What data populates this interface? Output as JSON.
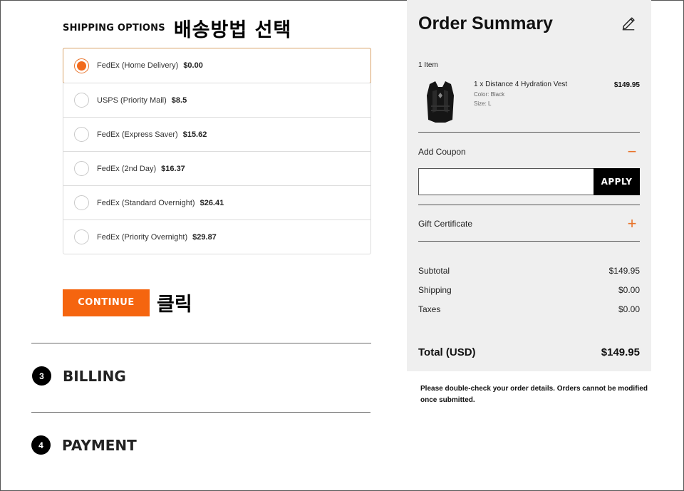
{
  "shipping": {
    "heading": "SHIPPING OPTIONS",
    "annotation": "배송방법 선택",
    "options": [
      {
        "name": "FedEx (Home Delivery)",
        "price": "$0.00",
        "selected": true
      },
      {
        "name": "USPS (Priority Mail)",
        "price": "$8.5",
        "selected": false
      },
      {
        "name": "FedEx (Express Saver)",
        "price": "$15.62",
        "selected": false
      },
      {
        "name": "FedEx (2nd Day)",
        "price": "$16.37",
        "selected": false
      },
      {
        "name": "FedEx (Standard Overnight)",
        "price": "$26.41",
        "selected": false
      },
      {
        "name": "FedEx (Priority Overnight)",
        "price": "$29.87",
        "selected": false
      }
    ],
    "continue_label": "CONTINUE",
    "click_annotation": "클릭"
  },
  "steps": [
    {
      "number": "3",
      "label": "BILLING"
    },
    {
      "number": "4",
      "label": "PAYMENT"
    }
  ],
  "summary": {
    "title": "Order Summary",
    "item_count": "1 Item",
    "product": {
      "name": "1 x Distance 4 Hydration Vest",
      "color": "Color: Black",
      "size": "Size: L",
      "price": "$149.95"
    },
    "coupon_label": "Add Coupon",
    "coupon_value": "",
    "apply_label": "APPLY",
    "gift_label": "Gift Certificate",
    "subtotal_label": "Subtotal",
    "subtotal_value": "$149.95",
    "shipping_label": "Shipping",
    "shipping_value": "$0.00",
    "taxes_label": "Taxes",
    "taxes_value": "$0.00",
    "total_label": "Total (USD)",
    "total_value": "$149.95",
    "note": "Please double-check your order details. Orders cannot be modified once submitted."
  },
  "colors": {
    "accent": "#f5650f",
    "summary_bg": "#efefef"
  },
  "icons": {
    "edit": "pencil-icon",
    "coupon_toggle": "minus-icon",
    "gift_toggle": "plus-icon"
  }
}
